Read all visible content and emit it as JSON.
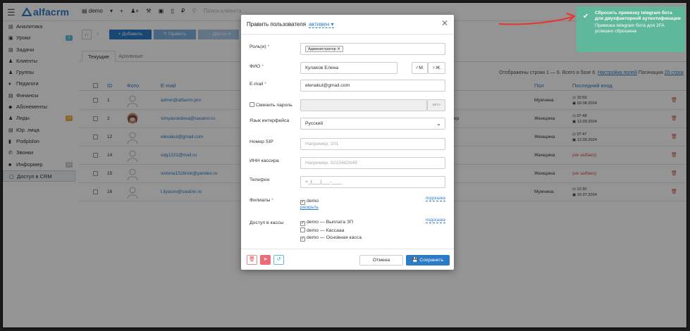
{
  "topbar": {
    "logo_text": "alfacrm",
    "branch_label": "demo",
    "search_placeholder": "Поиск клиента",
    "icons": [
      "add-icon",
      "user-add-icon",
      "wrench-icon",
      "wallet-icon",
      "mobile-icon",
      "ruble-icon",
      "search-icon"
    ]
  },
  "sidebar": {
    "items": [
      {
        "label": "Аналитика",
        "icon": "chart-icon"
      },
      {
        "label": "Уроки",
        "icon": "calendar-icon",
        "badge": "2",
        "badge_color": "#5bc0de"
      },
      {
        "label": "Задачи",
        "icon": "task-icon"
      },
      {
        "label": "Клиенты",
        "icon": "user-icon"
      },
      {
        "label": "Группы",
        "icon": "group-icon"
      },
      {
        "label": "Педагоги",
        "icon": "teacher-icon"
      },
      {
        "label": "Финансы",
        "icon": "money-icon"
      },
      {
        "label": "Абонементы",
        "icon": "tag-icon"
      },
      {
        "label": "Лиды",
        "icon": "lead-icon",
        "badge": "13",
        "badge_color": "#f0ad4e"
      },
      {
        "label": "Юр. лица",
        "icon": "bank-icon"
      },
      {
        "label": "Podpislon",
        "icon": "doc-icon"
      },
      {
        "label": "Звонки",
        "icon": "phone-icon"
      },
      {
        "label": "Информер",
        "icon": "informer-icon",
        "badge": "10",
        "badge_color": "#cccccc"
      },
      {
        "label": "Доступ в CRM",
        "icon": "lock-icon"
      }
    ]
  },
  "actions": {
    "add_label": "+ Добавить",
    "edit_label": "Править",
    "other_label": "Другое"
  },
  "tabs": [
    {
      "label": "Текущие"
    },
    {
      "label": "Архивные"
    }
  ],
  "meta": {
    "shown_text": "Отображены строки 1 — 6. Всего в базе 6.",
    "fields_link": "Настройка полей",
    "pagination_text": "Пагинация",
    "pagination_value": "20 строк"
  },
  "table": {
    "headers": {
      "id": "ID",
      "photo": "Фото",
      "email": "E-mail",
      "gender": "Пол",
      "last_login": "Последний вход"
    },
    "rows": [
      {
        "id": "1",
        "email": "admin@alfacrm.pro",
        "gender": "Мужчина",
        "time": "15:59",
        "date": "02.08.2024",
        "photo": "placeholder"
      },
      {
        "id": "2",
        "email": "simyasoedova@sasanrr.ru",
        "gender": "Женщина",
        "time": "07:48",
        "date": "12.09.2024",
        "photo": "real",
        "extra": "ер"
      },
      {
        "id": "12",
        "email": "elenakul@gmail.com",
        "gender": "Женщина",
        "time": "07:47",
        "date": "12.09.2024",
        "photo": "placeholder"
      },
      {
        "id": "14",
        "email": "sdg1222@mail.ru",
        "gender": "Женщина",
        "login_text": "(не задано)",
        "photo": "placeholder"
      },
      {
        "id": "15",
        "email": "victoria1526rick@yandex.ru",
        "gender": "Женщина",
        "login_text": "(не задано)",
        "photo": "placeholder"
      },
      {
        "id": "16",
        "email": "t.ilyasov@sastinn.ru",
        "gender": "Мужчина",
        "time": "12:30",
        "date": "15.07.2024",
        "photo": "placeholder"
      }
    ]
  },
  "modal": {
    "title": "Править пользователя",
    "status": "активен",
    "fields": {
      "roles_label": "Роль(и)",
      "roles_value": "Администратор",
      "fio_label": "ФИО",
      "fio_value": "Кулаков Елена",
      "gender_m": "М.",
      "gender_f": "Ж.",
      "email_label": "E-mail",
      "email_value": "elenakul@gmail.com",
      "password_label": "Сменить пароль",
      "password_auto": "авто",
      "lang_label": "Язык интерфейса",
      "lang_value": "Русский",
      "sip_label": "Номер SIP",
      "sip_placeholder": "Например, 101",
      "inn_label": "ИНН кассира",
      "inn_placeholder": "Например, 8215682645",
      "phone_label": "Телефон",
      "phone_mask": "+_(___)___-____",
      "branches_label": "Филиалы",
      "branches_hint": "подсказка",
      "branch_item": "demo",
      "expand_link": "раскрыть",
      "cash_label": "Доступ в кассы",
      "cash_hint": "подсказка",
      "cash_items": [
        {
          "label": "demo — Выплата ЗП",
          "checked": true
        },
        {
          "label": "demo — Кассааа",
          "checked": false
        },
        {
          "label": "demo — Основная касса",
          "checked": true
        }
      ]
    },
    "footer": {
      "cancel_label": "Отмена",
      "save_label": "Сохранить"
    }
  },
  "toast": {
    "title": "Сбросить привязку telegram бота для двухфакторной аутентификации",
    "body": "Привязка telegram бота для 2FA успешно сброшена"
  },
  "colors": {
    "brand_blue": "#2b7bc6",
    "toast_green": "#5fb89b",
    "danger_red": "#d9534f",
    "arrow_red": "#e8352c"
  }
}
